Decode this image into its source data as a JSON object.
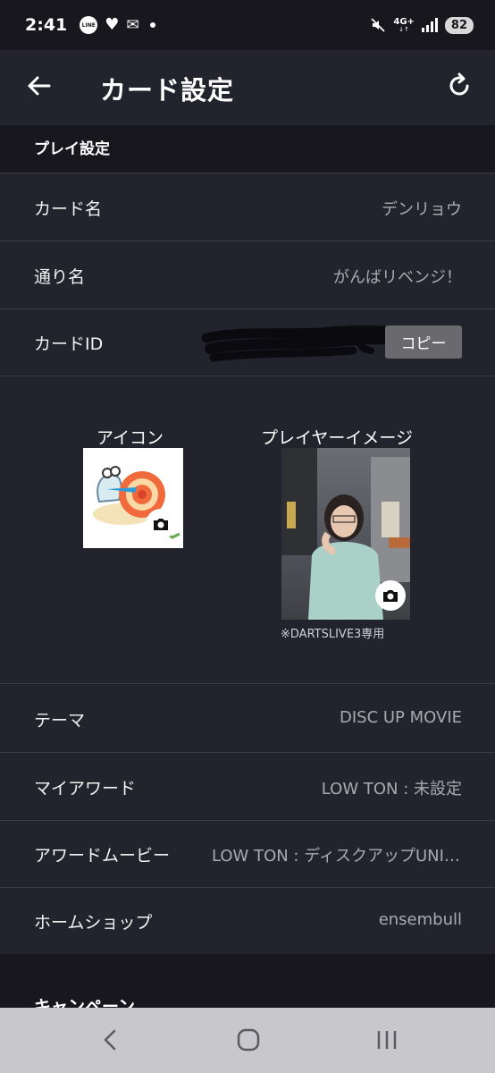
{
  "status_bar": {
    "time": "2:41",
    "line_badge": "LINE",
    "network": "4G+",
    "battery": "82",
    "icons": [
      "line-icon",
      "heart-icon",
      "mail-icon",
      "dot-icon",
      "mute-icon",
      "signal-icon",
      "battery-icon"
    ]
  },
  "header": {
    "title": "カード設定"
  },
  "section": {
    "title": "プレイ設定"
  },
  "rows": {
    "card_name": {
      "label": "カード名",
      "value": "デンリョウ"
    },
    "street_name": {
      "label": "通り名",
      "value": "がんばリベンジ！"
    },
    "card_id": {
      "label": "カードID",
      "copy_label": "コピー"
    },
    "theme": {
      "label": "テーマ",
      "value": "DISC UP MOVIE"
    },
    "my_award": {
      "label": "マイアワード",
      "value": "LOW TON : 未設定"
    },
    "award_movie": {
      "label": "アワードムービー",
      "value": "LOW TON : ディスクアップUNIVERSE"
    },
    "home_shop": {
      "label": "ホームショップ",
      "value": "ensembull"
    }
  },
  "images": {
    "icon_label": "アイコン",
    "player_label": "プレイヤーイメージ",
    "player_note": "※DARTSLIVE3専用"
  },
  "next_section": {
    "title": "キャンペーン"
  },
  "colors": {
    "background": "#23232d",
    "header_dark": "#17171d",
    "copy_button": "#6a6a6e",
    "value_text": "#a9a9b2",
    "nav_bar": "#c8c8cc"
  }
}
